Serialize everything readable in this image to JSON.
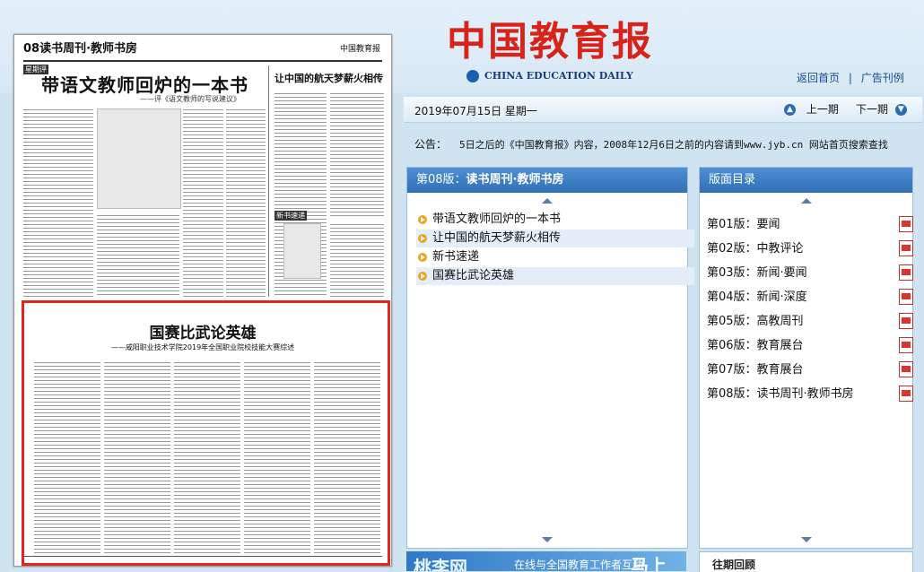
{
  "header": {
    "logo_cn": "中国教育报",
    "logo_en": "CHINA EDUCATION DAILY",
    "links": [
      "返回首页",
      "广告刊例"
    ],
    "link_sep": "|"
  },
  "datebar": {
    "date": "2019年07月15日 星期一",
    "prev": "上一期",
    "next": "下一期"
  },
  "notice": {
    "label": "公告：",
    "text": "5日之后的《中国教育报》内容，2008年12月6日之前的内容请到www.jyb.cn 网站首页搜索查找"
  },
  "paper": {
    "section": "08读书周刊·教师书房",
    "masthead": "中国教育报",
    "tag1": "星期评",
    "article1_title": "带语文教师回炉的一本书",
    "article1_sub": "——评《语文教师的写说建议》",
    "article2_title": "让中国的航天梦薪火相传",
    "tag2": "新书速递",
    "article3_title": "国赛比武论英雄",
    "article3_sub": "——咸阳职业技术学院2019年全国职业院校技能大赛综述"
  },
  "articles_panel": {
    "title_prefix": "第08版：",
    "title": "读书周刊·教师书房",
    "items": [
      "带语文教师回炉的一本书",
      "让中国的航天梦薪火相传",
      "新书速递",
      "国赛比武论英雄"
    ]
  },
  "pages_panel": {
    "title": "版面目录",
    "items": [
      "第01版：要闻",
      "第02版：中教评论",
      "第03版：新闻·要闻",
      "第04版：新闻·深度",
      "第05版：高教周刊",
      "第06版：教育展台",
      "第07版：教育展台",
      "第08版：读书周刊·教师书房"
    ]
  },
  "banner": {
    "brand": "桃李网",
    "slogan": "在线与全国教育工作者互动",
    "tail": "马上"
  },
  "past": {
    "title": "往期回顾"
  },
  "colors": {
    "accent": "#2f70b8",
    "logo_red": "#d7231a",
    "highlight": "#e1261c"
  }
}
